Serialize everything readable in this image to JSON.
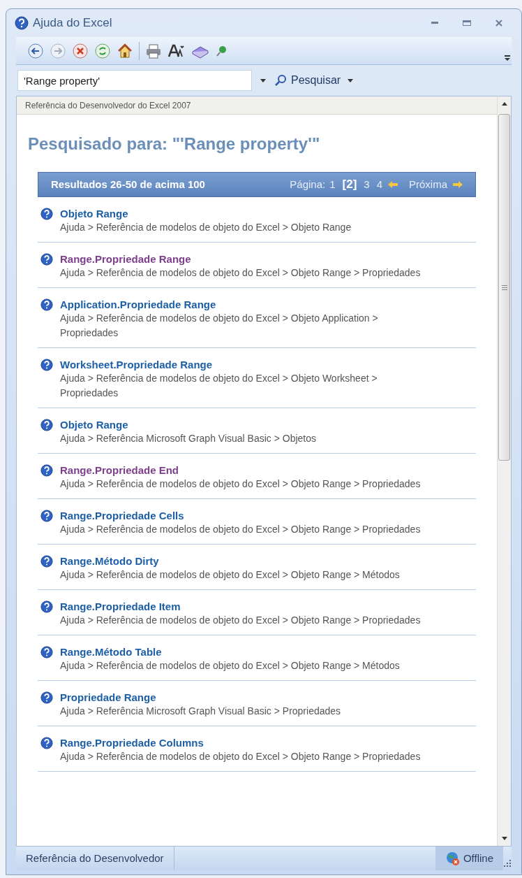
{
  "window": {
    "title": "Ajuda do Excel"
  },
  "search": {
    "value": "'Range property'",
    "button": "Pesquisar"
  },
  "location": "Referência do Desenvolvedor do Excel 2007",
  "heading": "Pesquisado para: \"'Range property'\"",
  "results_bar": {
    "summary": "Resultados 26-50 de acima 100",
    "page_label": "Página:",
    "pages": [
      {
        "label": "1",
        "selected": false
      },
      {
        "label": "[2]",
        "selected": true
      },
      {
        "label": "3",
        "selected": false
      },
      {
        "label": "4",
        "selected": false
      }
    ],
    "next": "Próxima"
  },
  "results": [
    {
      "title": "Objeto Range",
      "visited": false,
      "path": "Ajuda > Referência de modelos de objeto do Excel > Objeto Range"
    },
    {
      "title": "Range.Propriedade Range",
      "visited": true,
      "path": "Ajuda > Referência de modelos de objeto do Excel > Objeto Range > Propriedades"
    },
    {
      "title": "Application.Propriedade Range",
      "visited": false,
      "path": "Ajuda > Referência de modelos de objeto do Excel > Objeto Application > Propriedades"
    },
    {
      "title": "Worksheet.Propriedade Range",
      "visited": false,
      "path": "Ajuda > Referência de modelos de objeto do Excel > Objeto Worksheet > Propriedades"
    },
    {
      "title": "Objeto Range",
      "visited": false,
      "path": "Ajuda > Referência Microsoft Graph Visual Basic > Objetos"
    },
    {
      "title": "Range.Propriedade End",
      "visited": true,
      "path": "Ajuda > Referência de modelos de objeto do Excel > Objeto Range > Propriedades"
    },
    {
      "title": "Range.Propriedade Cells",
      "visited": false,
      "path": "Ajuda > Referência de modelos de objeto do Excel > Objeto Range > Propriedades"
    },
    {
      "title": "Range.Método Dirty",
      "visited": false,
      "path": "Ajuda > Referência de modelos de objeto do Excel > Objeto Range > Métodos"
    },
    {
      "title": "Range.Propriedade Item",
      "visited": false,
      "path": "Ajuda > Referência de modelos de objeto do Excel > Objeto Range > Propriedades"
    },
    {
      "title": "Range.Método Table",
      "visited": false,
      "path": "Ajuda > Referência de modelos de objeto do Excel > Objeto Range > Métodos"
    },
    {
      "title": "Propriedade Range",
      "visited": false,
      "path": "Ajuda > Referência Microsoft Graph Visual Basic > Propriedades"
    },
    {
      "title": "Range.Propriedade Columns",
      "visited": false,
      "path": "Ajuda > Referência de modelos de objeto do Excel > Objeto Range > Propriedades"
    }
  ],
  "status_bar": {
    "section": "Referência do Desenvolvedor",
    "connection": "Offline"
  }
}
